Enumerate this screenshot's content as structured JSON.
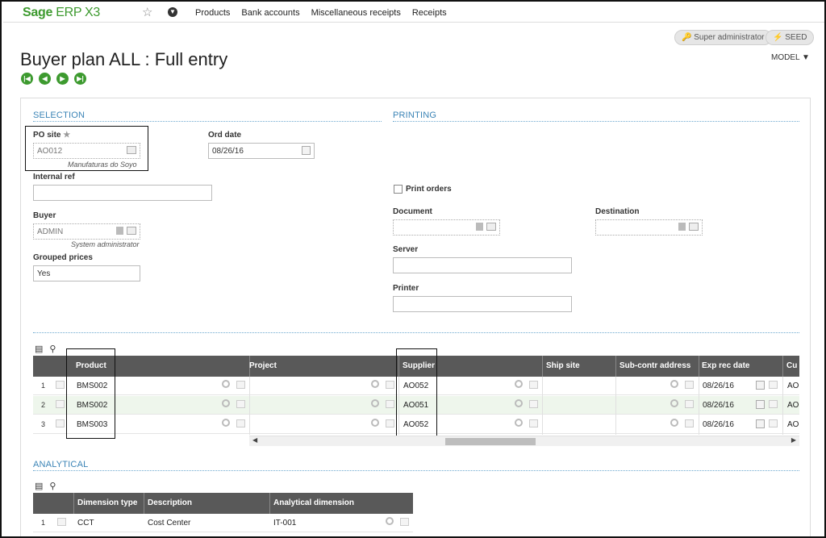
{
  "app": {
    "logo_brand": "Sage",
    "logo_product": "ERP X3",
    "nav_links": [
      "Products",
      "Bank accounts",
      "Miscellaneous receipts",
      "Receipts"
    ],
    "user_pill": "Super administrator",
    "folder_pill": "SEED",
    "model_label": "MODEL"
  },
  "page": {
    "title": "Buyer plan ALL : Full entry"
  },
  "selection": {
    "heading": "SELECTION",
    "po_site": {
      "label": "PO site",
      "value": "AO012",
      "description": "Manufaturas do Soyo"
    },
    "ord_date": {
      "label": "Ord date",
      "value": "08/26/16"
    },
    "internal_ref": {
      "label": "Internal ref",
      "value": ""
    },
    "buyer": {
      "label": "Buyer",
      "value": "ADMIN",
      "description": "System administrator"
    },
    "grouped_prices": {
      "label": "Grouped prices",
      "value": "Yes"
    }
  },
  "printing": {
    "heading": "PRINTING",
    "print_orders_label": "Print orders",
    "document_label": "Document",
    "destination_label": "Destination",
    "server_label": "Server",
    "printer_label": "Printer"
  },
  "lines_grid": {
    "columns": [
      "Product",
      "Project",
      "Supplier",
      "Ship site",
      "Sub-contr address",
      "Exp rec date",
      "Cu"
    ],
    "rows": [
      {
        "num": "1",
        "product": "BMS002",
        "supplier": "AO052",
        "exp_date": "08/26/16",
        "cu": "AO"
      },
      {
        "num": "2",
        "product": "BMS002",
        "supplier": "AO051",
        "exp_date": "08/26/16",
        "cu": "AO"
      },
      {
        "num": "3",
        "product": "BMS003",
        "supplier": "AO052",
        "exp_date": "08/26/16",
        "cu": "AO"
      }
    ]
  },
  "analytical": {
    "heading": "ANALYTICAL",
    "columns": [
      "Dimension type",
      "Description",
      "Analytical dimension"
    ],
    "rows": [
      {
        "num": "1",
        "type": "CCT",
        "description": "Cost Center",
        "dimension": "IT-001"
      }
    ]
  },
  "colors": {
    "brand_green": "#3d9a2f",
    "section_blue": "#3b84b6",
    "grid_header": "#595959"
  }
}
